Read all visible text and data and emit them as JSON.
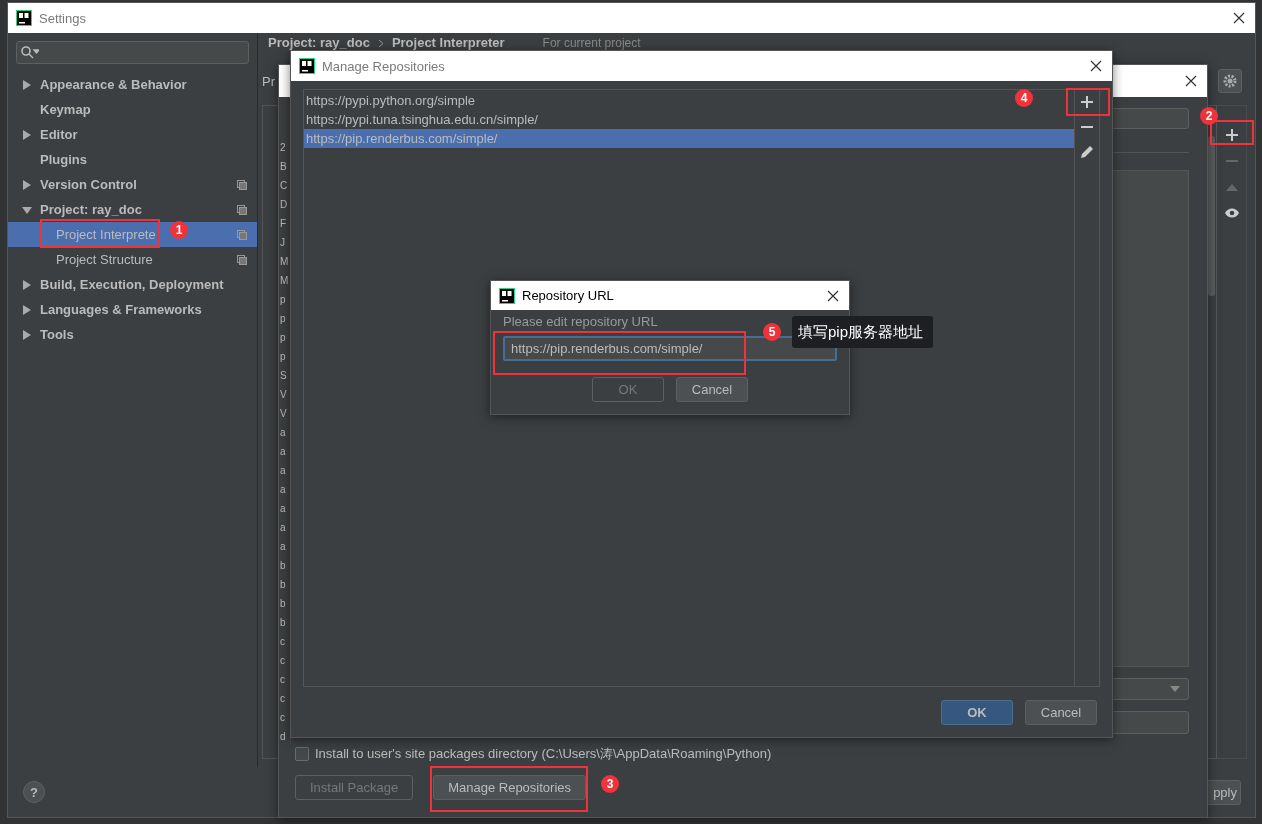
{
  "settings": {
    "title": "Settings",
    "sidebar": [
      {
        "label": "Appearance & Behavior",
        "expandable": true,
        "expanded": false,
        "selected": false,
        "project_scoped": false
      },
      {
        "label": "Keymap",
        "expandable": false,
        "selected": false,
        "project_scoped": false
      },
      {
        "label": "Editor",
        "expandable": true,
        "expanded": false,
        "selected": false,
        "project_scoped": false
      },
      {
        "label": "Plugins",
        "expandable": false,
        "selected": false,
        "project_scoped": false
      },
      {
        "label": "Version Control",
        "expandable": true,
        "expanded": false,
        "selected": false,
        "project_scoped": true
      },
      {
        "label": "Project: ray_doc",
        "expandable": true,
        "expanded": true,
        "selected": false,
        "project_scoped": true,
        "children": [
          {
            "label": "Project Interprete",
            "expandable": false,
            "selected": true,
            "project_scoped": true
          },
          {
            "label": "Project Structure",
            "expandable": false,
            "selected": false,
            "project_scoped": true
          }
        ]
      },
      {
        "label": "Build, Execution, Deployment",
        "expandable": true,
        "expanded": false,
        "selected": false,
        "project_scoped": false
      },
      {
        "label": "Languages & Frameworks",
        "expandable": true,
        "expanded": false,
        "selected": false,
        "project_scoped": false
      },
      {
        "label": "Tools",
        "expandable": true,
        "expanded": false,
        "selected": false,
        "project_scoped": false
      }
    ],
    "breadcrumb": [
      "Project: ray_doc",
      "Project Interpreter"
    ],
    "scope": "For current project",
    "interpreter_label": "Pr",
    "toolbar": [
      {
        "kind": "add",
        "disabled": false
      },
      {
        "kind": "remove",
        "disabled": true
      },
      {
        "kind": "up",
        "disabled": true
      },
      {
        "kind": "show",
        "disabled": false
      }
    ],
    "help": "?",
    "apply": "pply"
  },
  "available_packages": {
    "packages": [
      "2",
      "B",
      "C",
      "D",
      "F",
      "J",
      "M",
      "M",
      "p",
      "p",
      "p",
      "p",
      "S",
      "V",
      "V",
      "a",
      "a",
      "a",
      "a",
      "a",
      "a",
      "a",
      "b",
      "b",
      "b",
      "b",
      "c",
      "c",
      "c",
      "c",
      "c",
      "d"
    ],
    "install_option": {
      "label": "Install to user's site packages directory (C:\\Users\\涛\\AppData\\Roaming\\Python)",
      "checked": false
    },
    "buttons": [
      {
        "label": "Install Package",
        "disabled": true
      },
      {
        "label": "Manage Repositories",
        "disabled": false
      }
    ]
  },
  "manage_repositories": {
    "title": "Manage Repositories",
    "repositories": [
      {
        "url": "https://pypi.python.org/simple",
        "selected": false
      },
      {
        "url": "https://pypi.tuna.tsinghua.edu.cn/simple/",
        "selected": false
      },
      {
        "url": "https://pip.renderbus.com/simple/",
        "selected": true
      }
    ],
    "toolbar": [
      {
        "kind": "add"
      },
      {
        "kind": "remove"
      },
      {
        "kind": "edit"
      }
    ],
    "buttons": [
      {
        "label": "OK",
        "primary": true
      },
      {
        "label": "Cancel",
        "primary": false
      }
    ]
  },
  "repository_url": {
    "title": "Repository URL",
    "label": "Please edit repository URL",
    "value": "https://pip.renderbus.com/simple/",
    "buttons": [
      {
        "label": "OK",
        "disabled": true
      },
      {
        "label": "Cancel",
        "disabled": false
      }
    ]
  },
  "annotations": [
    {
      "number": "1"
    },
    {
      "number": "2"
    },
    {
      "number": "3"
    },
    {
      "number": "4"
    },
    {
      "number": "5",
      "note": "填写pip服务器地址"
    }
  ]
}
